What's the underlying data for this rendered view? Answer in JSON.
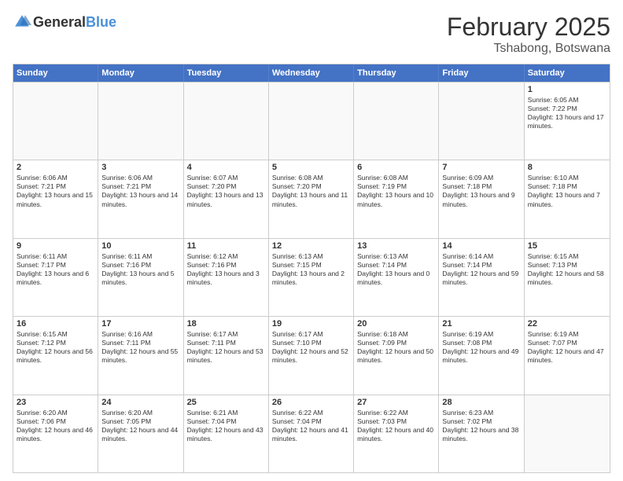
{
  "logo": {
    "general": "General",
    "blue": "Blue"
  },
  "title": "February 2025",
  "location": "Tshabong, Botswana",
  "days_of_week": [
    "Sunday",
    "Monday",
    "Tuesday",
    "Wednesday",
    "Thursday",
    "Friday",
    "Saturday"
  ],
  "weeks": [
    [
      {
        "day": "",
        "info": ""
      },
      {
        "day": "",
        "info": ""
      },
      {
        "day": "",
        "info": ""
      },
      {
        "day": "",
        "info": ""
      },
      {
        "day": "",
        "info": ""
      },
      {
        "day": "",
        "info": ""
      },
      {
        "day": "1",
        "info": "Sunrise: 6:05 AM\nSunset: 7:22 PM\nDaylight: 13 hours and 17 minutes."
      }
    ],
    [
      {
        "day": "2",
        "info": "Sunrise: 6:06 AM\nSunset: 7:21 PM\nDaylight: 13 hours and 15 minutes."
      },
      {
        "day": "3",
        "info": "Sunrise: 6:06 AM\nSunset: 7:21 PM\nDaylight: 13 hours and 14 minutes."
      },
      {
        "day": "4",
        "info": "Sunrise: 6:07 AM\nSunset: 7:20 PM\nDaylight: 13 hours and 13 minutes."
      },
      {
        "day": "5",
        "info": "Sunrise: 6:08 AM\nSunset: 7:20 PM\nDaylight: 13 hours and 11 minutes."
      },
      {
        "day": "6",
        "info": "Sunrise: 6:08 AM\nSunset: 7:19 PM\nDaylight: 13 hours and 10 minutes."
      },
      {
        "day": "7",
        "info": "Sunrise: 6:09 AM\nSunset: 7:18 PM\nDaylight: 13 hours and 9 minutes."
      },
      {
        "day": "8",
        "info": "Sunrise: 6:10 AM\nSunset: 7:18 PM\nDaylight: 13 hours and 7 minutes."
      }
    ],
    [
      {
        "day": "9",
        "info": "Sunrise: 6:11 AM\nSunset: 7:17 PM\nDaylight: 13 hours and 6 minutes."
      },
      {
        "day": "10",
        "info": "Sunrise: 6:11 AM\nSunset: 7:16 PM\nDaylight: 13 hours and 5 minutes."
      },
      {
        "day": "11",
        "info": "Sunrise: 6:12 AM\nSunset: 7:16 PM\nDaylight: 13 hours and 3 minutes."
      },
      {
        "day": "12",
        "info": "Sunrise: 6:13 AM\nSunset: 7:15 PM\nDaylight: 13 hours and 2 minutes."
      },
      {
        "day": "13",
        "info": "Sunrise: 6:13 AM\nSunset: 7:14 PM\nDaylight: 13 hours and 0 minutes."
      },
      {
        "day": "14",
        "info": "Sunrise: 6:14 AM\nSunset: 7:14 PM\nDaylight: 12 hours and 59 minutes."
      },
      {
        "day": "15",
        "info": "Sunrise: 6:15 AM\nSunset: 7:13 PM\nDaylight: 12 hours and 58 minutes."
      }
    ],
    [
      {
        "day": "16",
        "info": "Sunrise: 6:15 AM\nSunset: 7:12 PM\nDaylight: 12 hours and 56 minutes."
      },
      {
        "day": "17",
        "info": "Sunrise: 6:16 AM\nSunset: 7:11 PM\nDaylight: 12 hours and 55 minutes."
      },
      {
        "day": "18",
        "info": "Sunrise: 6:17 AM\nSunset: 7:11 PM\nDaylight: 12 hours and 53 minutes."
      },
      {
        "day": "19",
        "info": "Sunrise: 6:17 AM\nSunset: 7:10 PM\nDaylight: 12 hours and 52 minutes."
      },
      {
        "day": "20",
        "info": "Sunrise: 6:18 AM\nSunset: 7:09 PM\nDaylight: 12 hours and 50 minutes."
      },
      {
        "day": "21",
        "info": "Sunrise: 6:19 AM\nSunset: 7:08 PM\nDaylight: 12 hours and 49 minutes."
      },
      {
        "day": "22",
        "info": "Sunrise: 6:19 AM\nSunset: 7:07 PM\nDaylight: 12 hours and 47 minutes."
      }
    ],
    [
      {
        "day": "23",
        "info": "Sunrise: 6:20 AM\nSunset: 7:06 PM\nDaylight: 12 hours and 46 minutes."
      },
      {
        "day": "24",
        "info": "Sunrise: 6:20 AM\nSunset: 7:05 PM\nDaylight: 12 hours and 44 minutes."
      },
      {
        "day": "25",
        "info": "Sunrise: 6:21 AM\nSunset: 7:04 PM\nDaylight: 12 hours and 43 minutes."
      },
      {
        "day": "26",
        "info": "Sunrise: 6:22 AM\nSunset: 7:04 PM\nDaylight: 12 hours and 41 minutes."
      },
      {
        "day": "27",
        "info": "Sunrise: 6:22 AM\nSunset: 7:03 PM\nDaylight: 12 hours and 40 minutes."
      },
      {
        "day": "28",
        "info": "Sunrise: 6:23 AM\nSunset: 7:02 PM\nDaylight: 12 hours and 38 minutes."
      },
      {
        "day": "",
        "info": ""
      }
    ]
  ]
}
